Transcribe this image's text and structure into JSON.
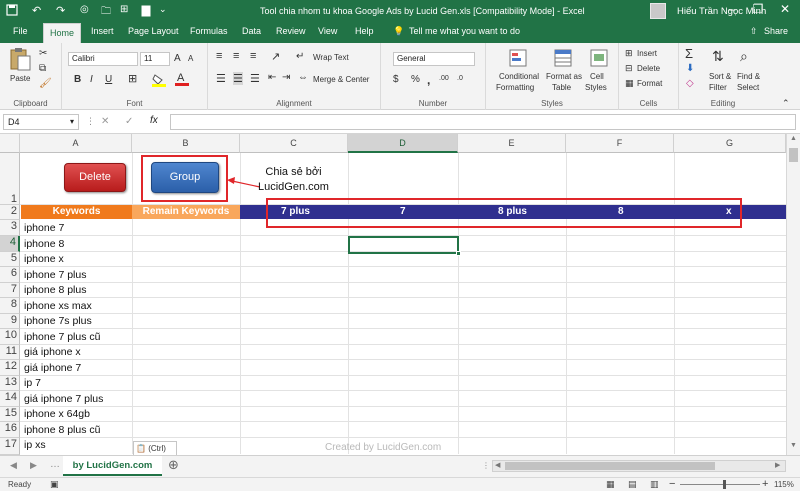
{
  "titlebar": {
    "title": "Tool chia nhom tu khoa Google Ads by Lucid Gen.xls  [Compatibility Mode]  -  Excel",
    "user": "Hiếu Trần Ngọc Minh"
  },
  "tabs": [
    "File",
    "Home",
    "Insert",
    "Page Layout",
    "Formulas",
    "Data",
    "Review",
    "View",
    "Help"
  ],
  "tellme": "Tell me what you want to do",
  "share": "Share",
  "ribbon": {
    "clipboard": {
      "label": "Clipboard",
      "paste": "Paste"
    },
    "font": {
      "label": "Font",
      "name": "Calibri",
      "size": "11",
      "bold": "B",
      "italic": "I",
      "underline": "U"
    },
    "alignment": {
      "label": "Alignment",
      "wrap": "Wrap Text",
      "merge": "Merge & Center"
    },
    "number": {
      "label": "Number",
      "format": "General",
      "pct": "%",
      "comma": ","
    },
    "styles": {
      "label": "Styles",
      "cond1": "Conditional",
      "cond2": "Formatting",
      "fmt1": "Format as",
      "fmt2": "Table",
      "cell1": "Cell",
      "cell2": "Styles"
    },
    "cells": {
      "label": "Cells",
      "insert": "Insert",
      "delete": "Delete",
      "format": "Format"
    },
    "editing": {
      "label": "Editing",
      "sort1": "Sort &",
      "sort2": "Filter",
      "find1": "Find &",
      "find2": "Select"
    }
  },
  "namebox": "D4",
  "columns": [
    "A",
    "B",
    "C",
    "D",
    "E",
    "F",
    "G"
  ],
  "rows": [
    "1",
    "2",
    "3",
    "4",
    "5",
    "6",
    "7",
    "8",
    "9",
    "10",
    "11",
    "12",
    "13",
    "14",
    "15",
    "16",
    "17"
  ],
  "buttons": {
    "delete": "Delete",
    "group": "Group"
  },
  "note": {
    "line1": "Chia sẻ bởi",
    "line2": "LucidGen.com"
  },
  "headers": {
    "keywords": "Keywords",
    "remain": "Remain Keywords"
  },
  "groups": [
    "7 plus",
    "7",
    "8 plus",
    "8",
    "x"
  ],
  "keywords": [
    "iphone 7",
    "iphone 8",
    "iphone x",
    "iphone 7 plus",
    "iphone 8 plus",
    "iphone xs max",
    "iphone 7s plus",
    "iphone 7 plus cũ",
    "giá iphone x",
    "giá iphone 7",
    "ip 7",
    "giá iphone 7 plus",
    "iphone x 64gb",
    "iphone 8 plus cũ",
    "ip xs"
  ],
  "paste_options": "(Ctrl)",
  "watermark": "Created by LucidGen.com",
  "sheet_tab": "by LucidGen.com",
  "status": {
    "ready": "Ready",
    "zoom": "115%"
  },
  "colors": {
    "excel_green": "#217346",
    "keywords_orange": "#f07a1c",
    "remain_orange": "#f9a75c",
    "group_blue": "#2f2f8f",
    "red_box": "#e0262a"
  }
}
